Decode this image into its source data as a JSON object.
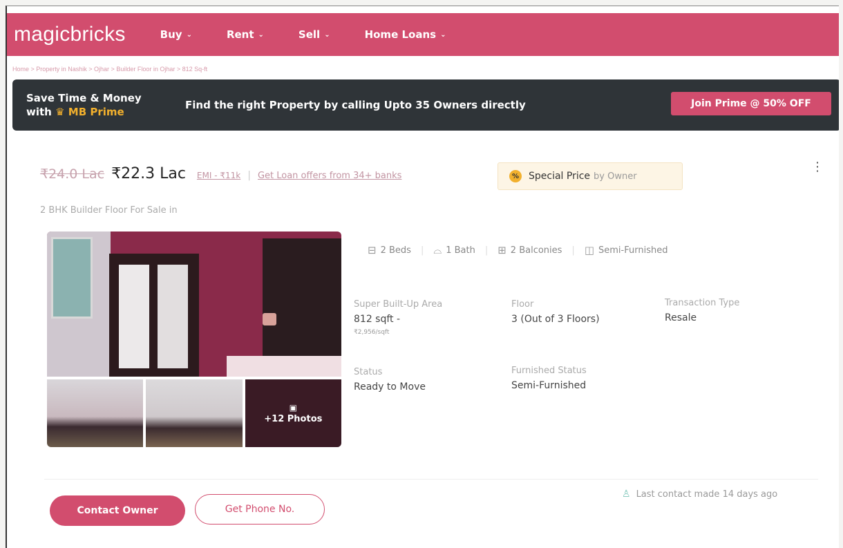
{
  "header": {
    "logo": "magicbricks",
    "nav": [
      {
        "label": "Buy"
      },
      {
        "label": "Rent"
      },
      {
        "label": "Sell"
      },
      {
        "label": "Home Loans"
      }
    ]
  },
  "breadcrumb": "Home > Property in Nashik > Ojhar > Builder Floor in Ojhar > 812 Sq-ft",
  "prime": {
    "line1": "Save Time & Money",
    "line2_prefix": "with",
    "line2_brand": "MB Prime",
    "message": "Find the right Property by calling Upto 35 Owners directly",
    "button": "Join Prime @ 50% OFF"
  },
  "listing": {
    "old_price": "₹24.0 Lac",
    "price": "₹22.3 Lac",
    "emi": "EMI - ₹11k",
    "loan_link": "Get Loan offers from 34+ banks",
    "special_bold": "Special Price",
    "special_light": "by Owner",
    "special_icon": "%",
    "subtitle": "2 BHK Builder Floor For Sale in",
    "photos_label": "+12 Photos",
    "features": [
      {
        "icon": "bed-icon",
        "label": "2 Beds"
      },
      {
        "icon": "bath-icon",
        "label": "1 Bath"
      },
      {
        "icon": "balcony-icon",
        "label": "2 Balconies"
      },
      {
        "icon": "furnish-icon",
        "label": "Semi-Furnished"
      }
    ],
    "specs": {
      "area_label": "Super Built-Up Area",
      "area_value": "812 sqft -",
      "area_rate": "₹2,956/sqft",
      "floor_label": "Floor",
      "floor_value": "3 (Out of 3 Floors)",
      "transaction_label": "Transaction Type",
      "transaction_value": "Resale",
      "status_label": "Status",
      "status_value": "Ready to Move",
      "furnished_label": "Furnished Status",
      "furnished_value": "Semi-Furnished"
    },
    "contact_button": "Contact Owner",
    "phone_button": "Get Phone No.",
    "last_contact": "Last contact made 14 days ago"
  },
  "colors": {
    "brand": "#d24d6e",
    "banner": "#2f3438",
    "prime_gold": "#f2b02d"
  }
}
